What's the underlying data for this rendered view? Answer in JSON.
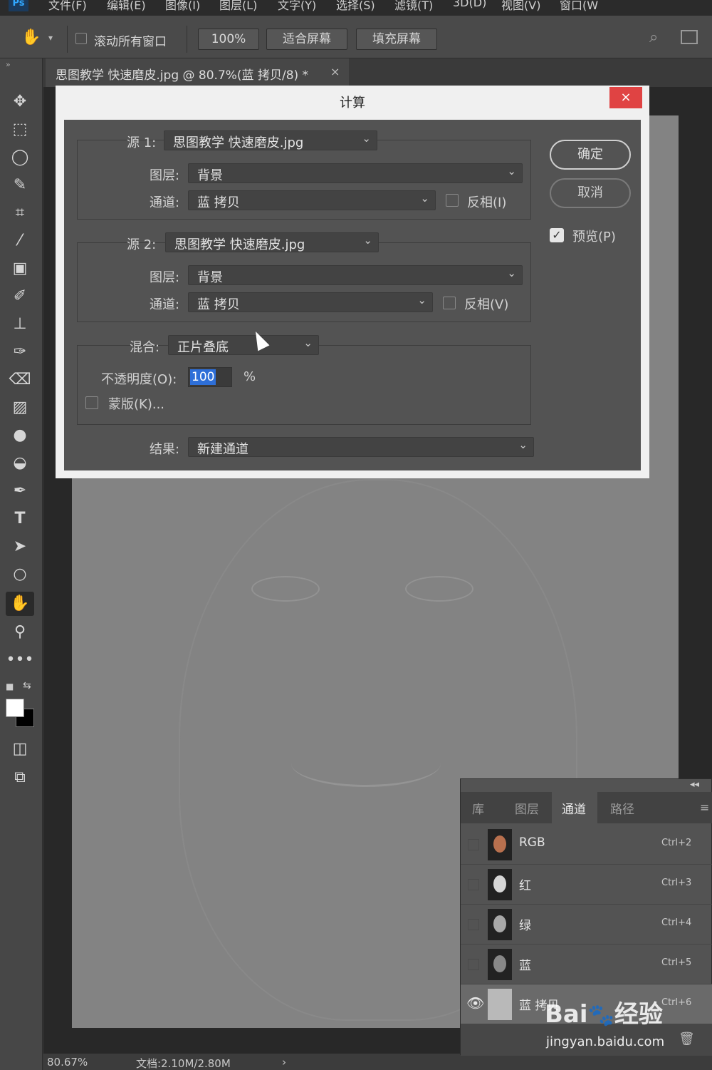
{
  "menu": {
    "logo": "Ps",
    "items": [
      "文件(F)",
      "编辑(E)",
      "图像(I)",
      "图层(L)",
      "文字(Y)",
      "选择(S)",
      "滤镜(T)",
      "3D(D)",
      "视图(V)",
      "窗口(W"
    ]
  },
  "options": {
    "scroll_all_label": "滚动所有窗口",
    "zoom_label": "100%",
    "fit_screen_label": "适合屏幕",
    "fill_screen_label": "填充屏幕"
  },
  "document": {
    "tab_title": "思图教学 快速磨皮.jpg @ 80.7%(蓝 拷贝/8) *",
    "close": "×"
  },
  "dialog": {
    "title": "计算",
    "close": "×",
    "source1": {
      "label": "源 1:",
      "file": "思图教学 快速磨皮.jpg",
      "layer_label": "图层:",
      "layer": "背景",
      "channel_label": "通道:",
      "channel": "蓝 拷贝",
      "invert_label": "反相(I)"
    },
    "source2": {
      "label": "源 2:",
      "file": "思图教学 快速磨皮.jpg",
      "layer_label": "图层:",
      "layer": "背景",
      "channel_label": "通道:",
      "channel": "蓝 拷贝",
      "invert_label": "反相(V)"
    },
    "blend": {
      "label": "混合:",
      "mode": "正片叠底",
      "opacity_label": "不透明度(O):",
      "opacity_value": "100",
      "opacity_unit": "%",
      "mask_label": "蒙版(K)..."
    },
    "result": {
      "label": "结果:",
      "value": "新建通道"
    },
    "ok_label": "确定",
    "cancel_label": "取消",
    "preview_label": "预览(P)",
    "preview_checked": true
  },
  "status": {
    "zoom": "80.67%",
    "doc_size": "文档:2.10M/2.80M",
    "arrow": "›"
  },
  "panel": {
    "tabs": [
      "库",
      "图层",
      "通道",
      "路径"
    ],
    "active_tab": "通道",
    "collapse": "◂◂",
    "menu": "≡",
    "channels": [
      {
        "name": "RGB",
        "shortcut": "Ctrl+2",
        "visible": false
      },
      {
        "name": "红",
        "shortcut": "Ctrl+3",
        "visible": false
      },
      {
        "name": "绿",
        "shortcut": "Ctrl+4",
        "visible": false
      },
      {
        "name": "蓝",
        "shortcut": "Ctrl+5",
        "visible": false
      },
      {
        "name": "蓝 拷贝",
        "shortcut": "Ctrl+6",
        "visible": true
      }
    ]
  },
  "watermark": {
    "logo": "Bai du 经验",
    "url": "jingyan.baidu.com"
  },
  "colors": {
    "accent_selection": "#2e6fd8",
    "close_red": "#e04343"
  }
}
